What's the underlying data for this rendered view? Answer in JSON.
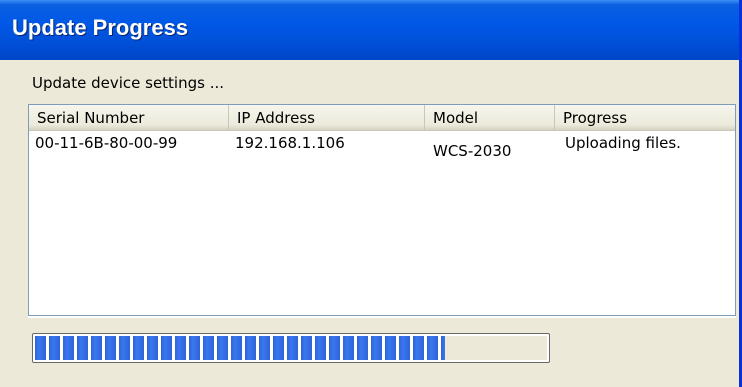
{
  "window": {
    "title": "Update Progress",
    "subtitle": "Update device settings ..."
  },
  "table": {
    "columns": [
      "Serial Number",
      "IP Address",
      "Model",
      "Progress"
    ],
    "rows": [
      {
        "serial": "00-11-6B-80-00-99",
        "ip": "192.168.1.106",
        "model": "WCS-2030",
        "progress": "Uploading files."
      }
    ]
  },
  "progress_bar": {
    "fraction": 0.8
  },
  "colors": {
    "title_bar": "#0054e3",
    "dialog_bg": "#ece9d8",
    "progress_block": "#3169e0"
  }
}
